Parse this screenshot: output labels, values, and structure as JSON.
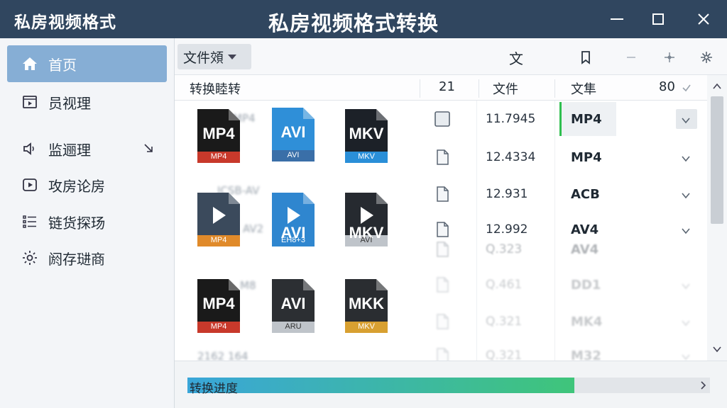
{
  "titlebar": {
    "app_name": "私房视频格式",
    "window_title": "私房视频格式转换",
    "buttons": [
      "minimize-icon",
      "maximize-icon",
      "close-icon"
    ]
  },
  "sidebar": {
    "items": [
      {
        "label": "首页",
        "icon": "home-icon",
        "active": true
      },
      {
        "label": "员视理",
        "icon": "video-file-icon"
      },
      {
        "label": "监逦理",
        "icon": "speaker-icon"
      },
      {
        "label": "攻房论房",
        "icon": "play-icon"
      },
      {
        "label": "链货探玚",
        "icon": "list-icon"
      },
      {
        "label": "阏存琎商",
        "icon": "gear-icon"
      }
    ]
  },
  "toolbar": {
    "dropdown_label": "文件頝",
    "text_button": "文",
    "icons": [
      "bookmark-icon",
      "minus-icon",
      "sparkle-icon",
      "settings-icon"
    ]
  },
  "columns": {
    "c1": "转换睦转",
    "c2": "21",
    "c3": "文件",
    "c4": "文隼",
    "c5": "80"
  },
  "file_icons": [
    {
      "label": "MP4",
      "sub": "MP4",
      "style": "red"
    },
    {
      "label": "AVI",
      "sub": "AVI",
      "style": "blue"
    },
    {
      "label": "MKV",
      "sub": "MKV",
      "style": "dark"
    },
    {
      "label": "",
      "sub": "MP4",
      "style": "play-dark"
    },
    {
      "label": "AVI",
      "sub": "EH8+3",
      "style": "play-blue"
    },
    {
      "label": "MKV",
      "sub": "AVI",
      "style": "play-grey"
    },
    {
      "label": "MP4",
      "sub": "MP4",
      "style": "red"
    },
    {
      "label": "AVI",
      "sub": "ARU",
      "style": "grey"
    },
    {
      "label": "MKK",
      "sub": "MKV",
      "style": "dark-yellow"
    }
  ],
  "ghost_labels": [
    "MP4",
    "JCSB-AV",
    "AV2",
    "M8",
    "2162 164"
  ],
  "rows": [
    {
      "num": "11.7945",
      "fmt": "MP4"
    },
    {
      "num": "12.4334",
      "fmt": "MP4"
    },
    {
      "num": "12.931",
      "fmt": "ACB"
    },
    {
      "num": "12.992",
      "fmt": "AV4"
    },
    {
      "num": "Q.323",
      "fmt": "AV4"
    },
    {
      "num": "Q.461",
      "fmt": "DD1"
    },
    {
      "num": "Q.321",
      "fmt": "MK4"
    },
    {
      "num": "Q.321",
      "fmt": "M32"
    }
  ],
  "progress": {
    "label": "转换进度",
    "fraction": 0.74
  },
  "colors": {
    "titlebar": "#30465f",
    "sidebar_active": "#86aed5",
    "progress_start": "#3aa6d9",
    "progress_end": "#3fc57a"
  }
}
